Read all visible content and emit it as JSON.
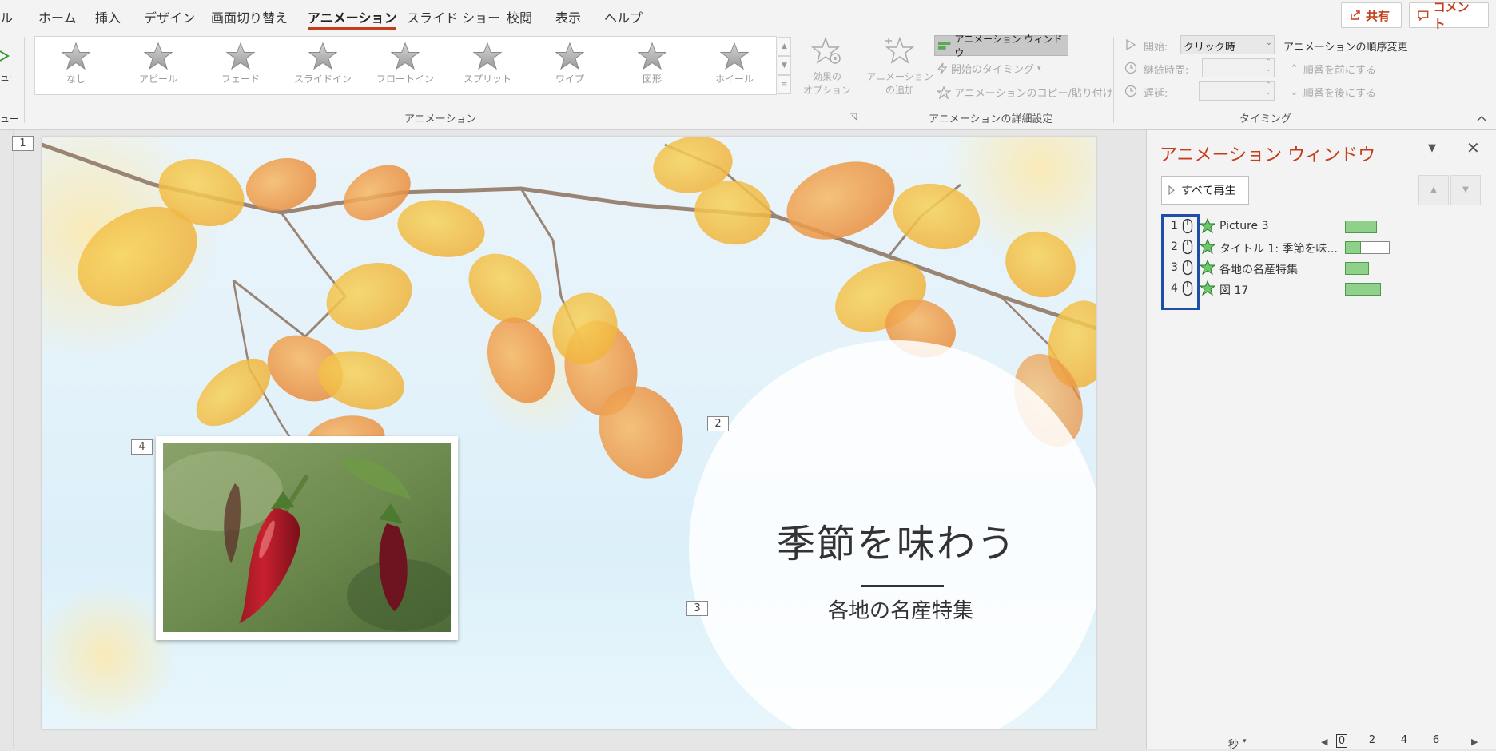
{
  "menu": {
    "tabs": [
      "ル",
      "ホーム",
      "挿入",
      "デザイン",
      "画面切り替え",
      "アニメーション",
      "スライド ショー",
      "校閲",
      "表示",
      "ヘルプ"
    ],
    "active_tab": "アニメーション",
    "share_label": "共有",
    "comment_label": "コメント"
  },
  "ribbon": {
    "left_cut_labels": [
      "ュー",
      "ュー"
    ],
    "gallery": [
      {
        "label": "なし",
        "icon": "star-none-icon"
      },
      {
        "label": "アピール",
        "icon": "star-appear-icon"
      },
      {
        "label": "フェード",
        "icon": "star-fade-icon"
      },
      {
        "label": "スライドイン",
        "icon": "star-flyin-icon"
      },
      {
        "label": "フロートイン",
        "icon": "star-floatin-icon"
      },
      {
        "label": "スプリット",
        "icon": "star-split-icon"
      },
      {
        "label": "ワイプ",
        "icon": "star-wipe-icon"
      },
      {
        "label": "図形",
        "icon": "star-shape-icon"
      },
      {
        "label": "ホイール",
        "icon": "star-wheel-icon"
      }
    ],
    "effect_options": {
      "line1": "効果の",
      "line2": "オプション"
    },
    "group_animation": "アニメーション",
    "add_animation": {
      "line1": "アニメーション",
      "line2": "の追加"
    },
    "animation_pane_button": "アニメーション ウィンドウ",
    "trigger": "開始のタイミング",
    "painter": "アニメーションのコピー/貼り付け",
    "group_advanced": "アニメーションの詳細設定",
    "start_label": "開始:",
    "start_value": "クリック時",
    "duration_label": "継続時間:",
    "delay_label": "遅延:",
    "reorder_title": "アニメーションの順序変更",
    "move_earlier": "順番を前にする",
    "move_later": "順番を後にする",
    "group_timing": "タイミング"
  },
  "slide": {
    "number_tag": "1",
    "title": "季節を味わう",
    "subtitle": "各地の名産特集",
    "tags": [
      "2",
      "3",
      "4"
    ]
  },
  "pane": {
    "title": "アニメーション ウィンドウ",
    "play_all": "すべて再生",
    "items": [
      {
        "index": "1",
        "name": "Picture 3",
        "bar_fraction": 1.0
      },
      {
        "index": "2",
        "name": "タイトル 1: 季節を味...",
        "bar_fraction": 0.35
      },
      {
        "index": "3",
        "name": "各地の名産特集",
        "bar_fraction": 1.0
      },
      {
        "index": "4",
        "name": "図 17",
        "bar_fraction": 1.0
      }
    ],
    "timeline_unit": "秒",
    "timeline_ticks": [
      "0",
      "2",
      "4",
      "6"
    ]
  },
  "colors": {
    "accent": "#c43e1c",
    "highlight_box": "#1f4ea8",
    "bar_green": "#8fd18a"
  }
}
